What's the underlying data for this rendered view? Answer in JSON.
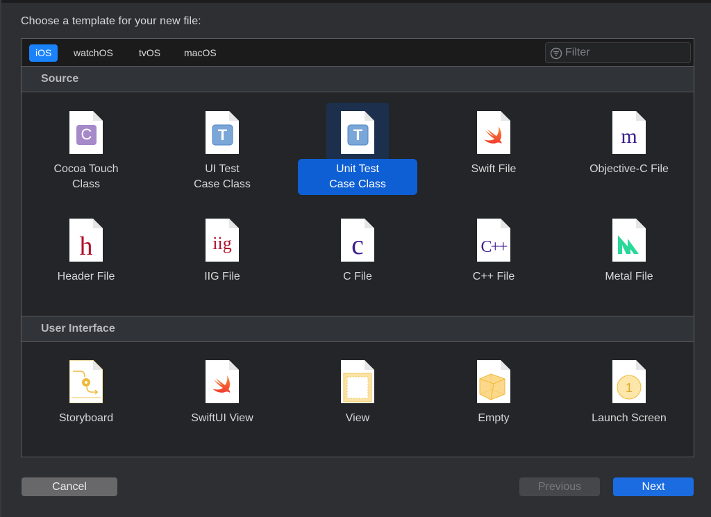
{
  "dialog": {
    "prompt": "Choose a template for your new file:"
  },
  "platform_tabs": [
    {
      "label": "iOS",
      "active": true
    },
    {
      "label": "watchOS",
      "active": false
    },
    {
      "label": "tvOS",
      "active": false
    },
    {
      "label": "macOS",
      "active": false
    }
  ],
  "filter": {
    "placeholder": "Filter",
    "value": "",
    "icon": "filter-icon"
  },
  "sections": [
    {
      "title": "Source",
      "templates": [
        {
          "label": "Cocoa Touch Class",
          "line1": "Cocoa Touch",
          "line2": "Class",
          "icon": "cocoa-touch-class-icon",
          "selected": false
        },
        {
          "label": "UI Test Case Class",
          "line1": "UI Test",
          "line2": "Case Class",
          "icon": "ui-test-case-class-icon",
          "selected": false
        },
        {
          "label": "Unit Test Case Class",
          "line1": "Unit Test",
          "line2": "Case Class",
          "icon": "unit-test-case-class-icon",
          "selected": true
        },
        {
          "label": "Swift File",
          "line1": "Swift File",
          "line2": "",
          "icon": "swift-file-icon",
          "selected": false
        },
        {
          "label": "Objective-C File",
          "line1": "Objective-C File",
          "line2": "",
          "icon": "objective-c-file-icon",
          "selected": false
        },
        {
          "label": "Header File",
          "line1": "Header File",
          "line2": "",
          "icon": "header-file-icon",
          "selected": false
        },
        {
          "label": "IIG File",
          "line1": "IIG File",
          "line2": "",
          "icon": "iig-file-icon",
          "selected": false
        },
        {
          "label": "C File",
          "line1": "C File",
          "line2": "",
          "icon": "c-file-icon",
          "selected": false
        },
        {
          "label": "C++ File",
          "line1": "C++ File",
          "line2": "",
          "icon": "cpp-file-icon",
          "selected": false
        },
        {
          "label": "Metal File",
          "line1": "Metal File",
          "line2": "",
          "icon": "metal-file-icon",
          "selected": false
        }
      ]
    },
    {
      "title": "User Interface",
      "templates": [
        {
          "label": "Storyboard",
          "line1": "Storyboard",
          "line2": "",
          "icon": "storyboard-icon",
          "selected": false
        },
        {
          "label": "SwiftUI View",
          "line1": "SwiftUI View",
          "line2": "",
          "icon": "swiftui-view-icon",
          "selected": false
        },
        {
          "label": "View",
          "line1": "View",
          "line2": "",
          "icon": "view-icon",
          "selected": false
        },
        {
          "label": "Empty",
          "line1": "Empty",
          "line2": "",
          "icon": "empty-icon",
          "selected": false
        },
        {
          "label": "Launch Screen",
          "line1": "Launch Screen",
          "line2": "",
          "icon": "launch-screen-icon",
          "selected": false
        }
      ]
    }
  ],
  "glyphs": {
    "cocoa": "C",
    "test": "T",
    "objc": "m",
    "header": "h",
    "iig": "iig",
    "c": "c",
    "cpp": "C++",
    "launch": "1"
  },
  "buttons": {
    "cancel": "Cancel",
    "previous": "Previous",
    "next": "Next",
    "previous_enabled": false
  },
  "colors": {
    "accent": "#1a82fb",
    "selection_label": "#0f5fd4",
    "selection_icon_bg": "#1c304d",
    "next_button": "#1b6ce0"
  }
}
